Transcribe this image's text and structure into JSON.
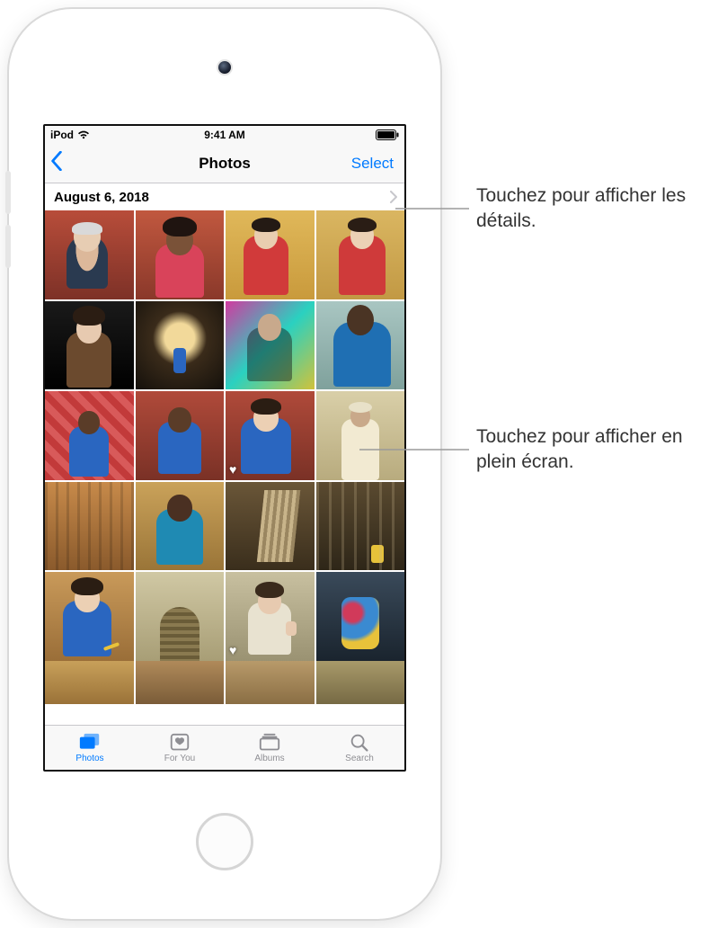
{
  "status": {
    "carrier": "iPod",
    "time": "9:41 AM"
  },
  "nav": {
    "title": "Photos",
    "select": "Select"
  },
  "section": {
    "date": "August 6, 2018"
  },
  "tabs": {
    "photos": "Photos",
    "foryou": "For You",
    "albums": "Albums",
    "search": "Search"
  },
  "callouts": {
    "details": "Touchez pour afficher les détails.",
    "fullscreen": "Touchez pour afficher en plein écran."
  },
  "favorite_indices": [
    10,
    18
  ]
}
